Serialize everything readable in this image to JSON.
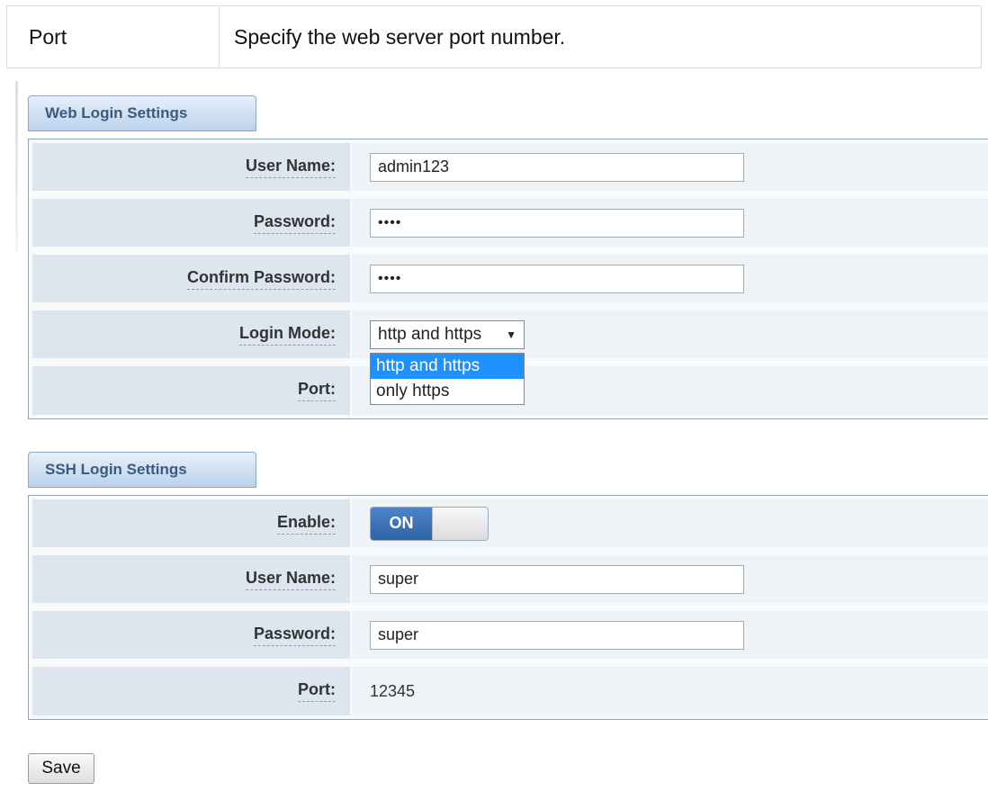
{
  "doc": {
    "key": "Port",
    "description": "Specify the web server port number."
  },
  "web_login": {
    "section_title": "Web Login Settings",
    "user_name_label": "User Name:",
    "user_name_value": "admin123",
    "password_label": "Password:",
    "password_value": "••••",
    "confirm_password_label": "Confirm Password:",
    "confirm_password_value": "••••",
    "login_mode_label": "Login Mode:",
    "login_mode_selected": "http and https",
    "login_mode_options": [
      "http and https",
      "only https"
    ],
    "port_label": "Port:"
  },
  "ssh_login": {
    "section_title": "SSH Login Settings",
    "enable_label": "Enable:",
    "enable_state": "ON",
    "user_name_label": "User Name:",
    "user_name_value": "super",
    "password_label": "Password:",
    "password_value": "super",
    "port_label": "Port:",
    "port_value": "12345"
  },
  "actions": {
    "save_label": "Save"
  },
  "colors": {
    "accent_blue": "#1e90ff",
    "toggle_on": "#3a6db3",
    "label_bg": "#dde6ef"
  }
}
